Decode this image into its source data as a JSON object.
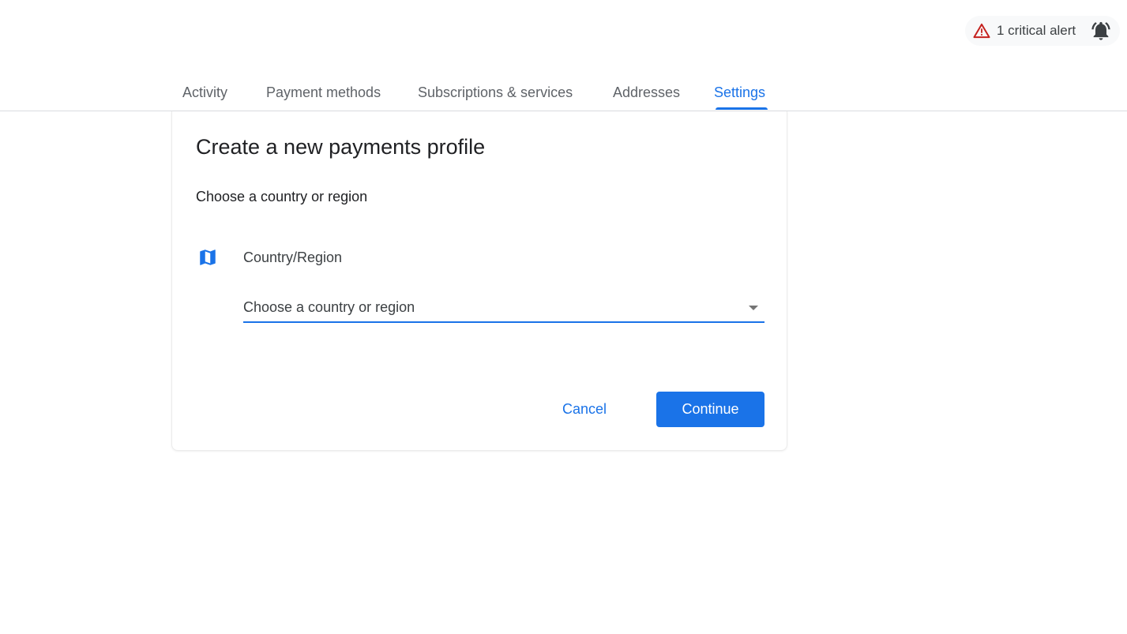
{
  "alert": {
    "text": "1 critical alert",
    "icon": "warning-triangle-icon",
    "bell_icon": "notifications-active-icon",
    "color": "#c5221f"
  },
  "tabs": [
    {
      "label": "Activity",
      "active": false
    },
    {
      "label": "Payment methods",
      "active": false
    },
    {
      "label": "Subscriptions & services",
      "active": false
    },
    {
      "label": "Addresses",
      "active": false
    },
    {
      "label": "Settings",
      "active": true
    }
  ],
  "dialog": {
    "title": "Create a new payments profile",
    "subtitle": "Choose a country or region",
    "field": {
      "icon": "map-icon",
      "label": "Country/Region",
      "placeholder": "Choose a country or region",
      "value": ""
    },
    "cancel_label": "Cancel",
    "continue_label": "Continue"
  },
  "colors": {
    "accent": "#1a73e8",
    "text_primary": "#202124",
    "text_secondary": "#5f6368"
  }
}
